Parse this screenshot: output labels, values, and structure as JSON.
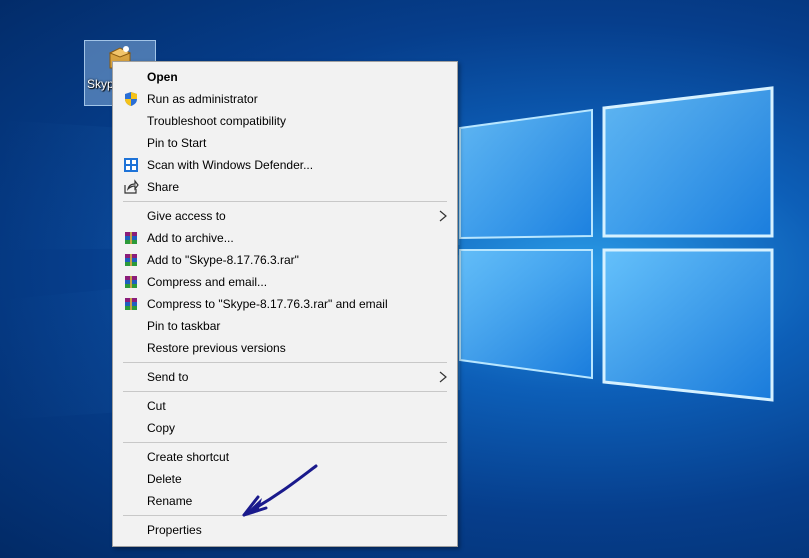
{
  "desktop": {
    "icon_label": "Skype",
    "accent": "#0a64c8"
  },
  "context_menu": {
    "items": [
      {
        "label": "Open",
        "icon": "none",
        "bold": true
      },
      {
        "label": "Run as administrator",
        "icon": "uac-shield-icon"
      },
      {
        "label": "Troubleshoot compatibility",
        "icon": "none"
      },
      {
        "label": "Pin to Start",
        "icon": "none"
      },
      {
        "label": "Scan with Windows Defender...",
        "icon": "windows-defender-icon"
      },
      {
        "label": "Share",
        "icon": "share-icon"
      },
      {
        "label": "Give access to",
        "icon": "none",
        "submenu": true
      },
      {
        "label": "Add to archive...",
        "icon": "winrar-icon"
      },
      {
        "label": "Add to \"Skype-8.17.76.3.rar\"",
        "icon": "winrar-icon"
      },
      {
        "label": "Compress and email...",
        "icon": "winrar-icon"
      },
      {
        "label": "Compress to \"Skype-8.17.76.3.rar\" and email",
        "icon": "winrar-icon"
      },
      {
        "label": "Pin to taskbar",
        "icon": "none"
      },
      {
        "label": "Restore previous versions",
        "icon": "none"
      },
      {
        "label": "Send to",
        "icon": "none",
        "submenu": true
      },
      {
        "label": "Cut",
        "icon": "none"
      },
      {
        "label": "Copy",
        "icon": "none"
      },
      {
        "label": "Create shortcut",
        "icon": "none"
      },
      {
        "label": "Delete",
        "icon": "none"
      },
      {
        "label": "Rename",
        "icon": "none"
      },
      {
        "label": "Properties",
        "icon": "none"
      }
    ]
  },
  "annotation": {
    "highlight_color": "#f4f427",
    "arrow_color": "#1a1a8c"
  }
}
